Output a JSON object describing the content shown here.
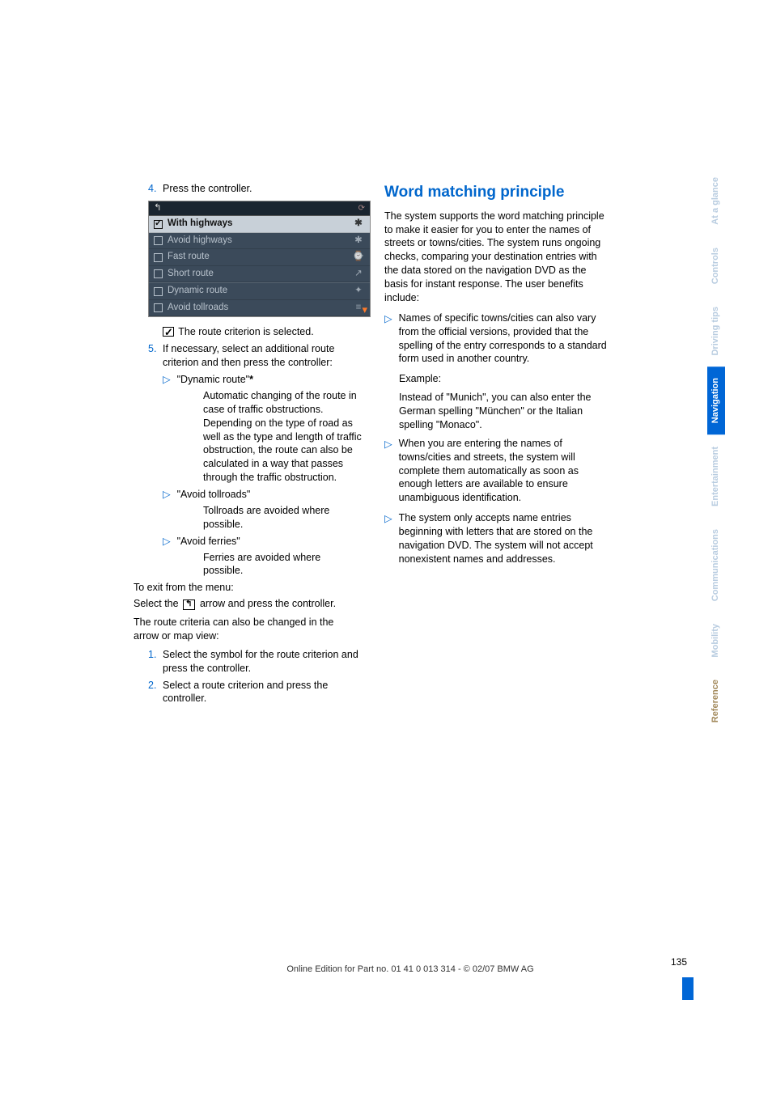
{
  "left": {
    "step4_num": "4.",
    "step4_text": "Press the controller.",
    "screenshot": {
      "rows": [
        {
          "label": "With highways",
          "checked": true,
          "icon": "✱",
          "sel": true
        },
        {
          "label": "Avoid highways",
          "checked": false,
          "icon": "✱"
        },
        {
          "label": "Fast route",
          "checked": false,
          "icon": "⌚"
        },
        {
          "label": "Short route",
          "checked": false,
          "icon": "↗"
        },
        {
          "label": "Dynamic route",
          "checked": false,
          "icon": "✦",
          "grp": true
        },
        {
          "label": "Avoid tollroads",
          "checked": false,
          "icon": "≡"
        }
      ]
    },
    "selected_text": " The route criterion is selected.",
    "step5_num": "5.",
    "step5_text": "If necessary, select an additional route criterion and then press the controller:",
    "bullets": [
      {
        "label": "\"Dynamic route\"",
        "star": "*",
        "sub": "Automatic changing of the route in case of traffic obstructions. Depending on the type of road as well as the type and length of traffic obstruction, the route can also be calculated in a way that passes through the traffic obstruction."
      },
      {
        "label": "\"Avoid tollroads\"",
        "sub": "Tollroads are avoided where possible."
      },
      {
        "label": "\"Avoid ferries\"",
        "sub": "Ferries are avoided where possible."
      }
    ],
    "exit_text": "To exit from the menu:",
    "select_pre": "Select the ",
    "select_post": " arrow and press the controller.",
    "criteria_text": "The route criteria can also be changed in the arrow or map view:",
    "num_items": [
      {
        "num": "1.",
        "text": "Select the symbol for the route criterion and press the controller."
      },
      {
        "num": "2.",
        "text": "Select a route criterion and press the controller."
      }
    ]
  },
  "right": {
    "heading": "Word matching principle",
    "intro": "The system supports the word matching principle to make it easier for you to enter the names of streets or towns/cities. The system runs ongoing checks, comparing your destination entries with the data stored on the navigation DVD as the basis for instant response. The user benefits include:",
    "b1": "Names of specific towns/cities can also vary from the official versions, provided that the spelling of the entry corresponds to a standard form used in another country.",
    "b1_ex_label": "Example:",
    "b1_ex": "Instead of \"Munich\", you can also enter the German spelling \"München\" or the Italian spelling \"Monaco\".",
    "b2": "When you are entering the names of towns/cities and streets, the system will complete them automatically as soon as enough letters are available to ensure unambiguous identification.",
    "b3": "The system only accepts name entries beginning with letters that are stored on the navigation DVD. The system will not accept nonexistent names and addresses."
  },
  "tabs": {
    "t1": "At a glance",
    "t2": "Controls",
    "t3": "Driving tips",
    "t4": "Navigation",
    "t5": "Entertainment",
    "t6": "Communications",
    "t7": "Mobility",
    "t8": "Reference"
  },
  "footer": {
    "page": "135",
    "edition": "Online Edition for Part no. 01 41 0 013 314 - © 02/07 BMW AG"
  }
}
